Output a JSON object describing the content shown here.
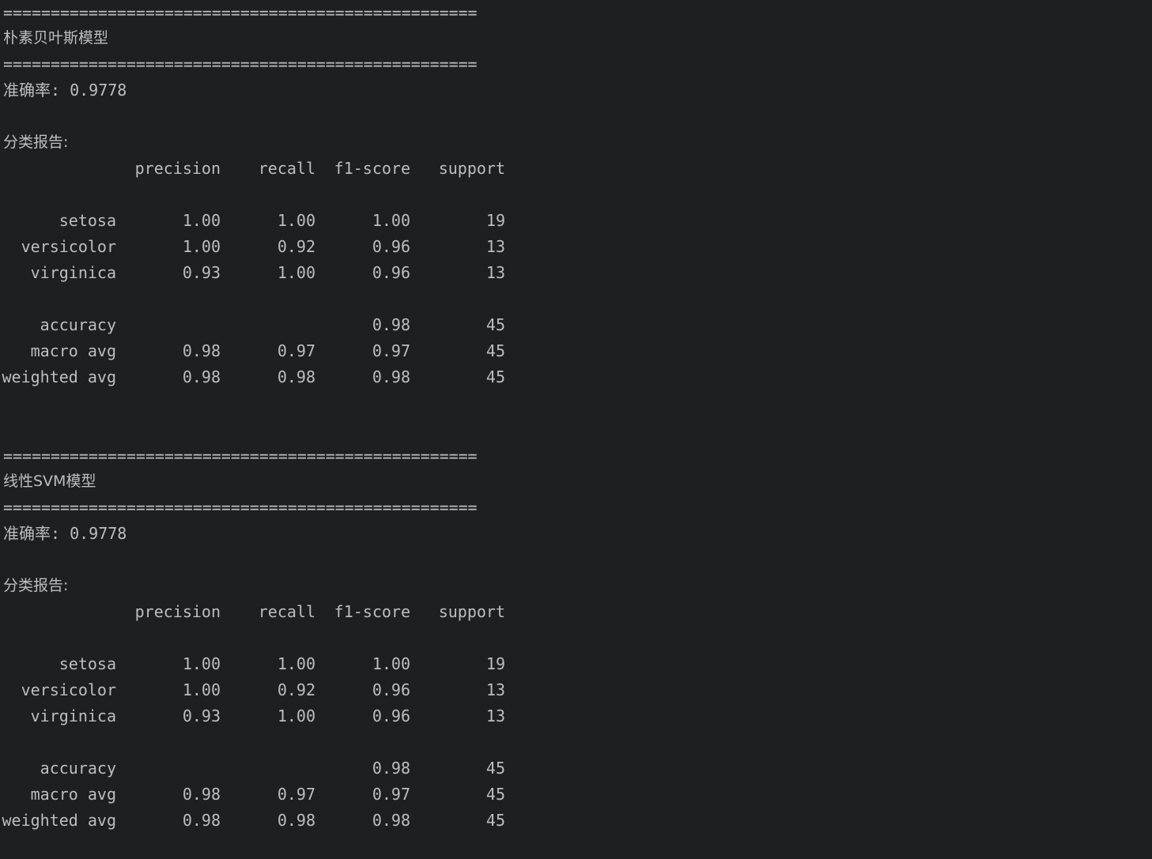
{
  "separator": "==================================================",
  "sections": [
    {
      "title": "朴素贝叶斯模型",
      "accuracy_line": "准确率: 0.9778",
      "report_label": "分类报告:",
      "headers": [
        "precision",
        "recall",
        "f1-score",
        "support"
      ],
      "rows": [
        {
          "label": "setosa",
          "precision": "1.00",
          "recall": "1.00",
          "f1": "1.00",
          "support": "19"
        },
        {
          "label": "versicolor",
          "precision": "1.00",
          "recall": "0.92",
          "f1": "0.96",
          "support": "13"
        },
        {
          "label": "virginica",
          "precision": "0.93",
          "recall": "1.00",
          "f1": "0.96",
          "support": "13"
        }
      ],
      "summary": [
        {
          "label": "accuracy",
          "precision": "",
          "recall": "",
          "f1": "0.98",
          "support": "45"
        },
        {
          "label": "macro avg",
          "precision": "0.98",
          "recall": "0.97",
          "f1": "0.97",
          "support": "45"
        },
        {
          "label": "weighted avg",
          "precision": "0.98",
          "recall": "0.98",
          "f1": "0.98",
          "support": "45"
        }
      ]
    },
    {
      "title": "线性SVM模型",
      "accuracy_line": "准确率: 0.9778",
      "report_label": "分类报告:",
      "headers": [
        "precision",
        "recall",
        "f1-score",
        "support"
      ],
      "rows": [
        {
          "label": "setosa",
          "precision": "1.00",
          "recall": "1.00",
          "f1": "1.00",
          "support": "19"
        },
        {
          "label": "versicolor",
          "precision": "1.00",
          "recall": "0.92",
          "f1": "0.96",
          "support": "13"
        },
        {
          "label": "virginica",
          "precision": "0.93",
          "recall": "1.00",
          "f1": "0.96",
          "support": "13"
        }
      ],
      "summary": [
        {
          "label": "accuracy",
          "precision": "",
          "recall": "",
          "f1": "0.98",
          "support": "45"
        },
        {
          "label": "macro avg",
          "precision": "0.98",
          "recall": "0.97",
          "f1": "0.97",
          "support": "45"
        },
        {
          "label": "weighted avg",
          "precision": "0.98",
          "recall": "0.98",
          "f1": "0.98",
          "support": "45"
        }
      ]
    }
  ]
}
